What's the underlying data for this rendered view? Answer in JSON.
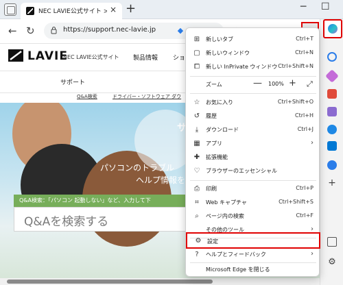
{
  "tab": {
    "title": "NEC LAVIE公式サイト > サービス＆サ",
    "close": "×",
    "new_tab": "+"
  },
  "window": {
    "minimize": "─",
    "maximize": "☐"
  },
  "address": {
    "url": "https://support.nec-lavie.jp"
  },
  "toolbar": {
    "more": "···",
    "read_aloud": "Aᴬ"
  },
  "site": {
    "logo_text": "LAVIE",
    "site_name": "NEC LAVIE公式サイト",
    "nav_product": "製品情報",
    "nav_cut": "ショ",
    "support": "サポート",
    "links": [
      "Q&A検索",
      "ドライバー・ソフトウェア ダウ"
    ]
  },
  "hero": {
    "heading_partial": "サ",
    "line1": "パソコンのトラブル",
    "line2": "ヘルプ情報を",
    "qa_label": "Q&A検索：「パソコン 起動しない」など、入力して下",
    "qa_placeholder": "Q&Aを検索する"
  },
  "menu": {
    "items": [
      {
        "label": "新しいタブ",
        "shortcut": "Ctrl+T",
        "icon": "new-tab-icon"
      },
      {
        "label": "新しいウィンドウ",
        "shortcut": "Ctrl+N",
        "icon": "new-window-icon"
      },
      {
        "label": "新しい InPrivate ウィンドウ",
        "shortcut": "Ctrl+Shift+N",
        "icon": "inprivate-icon"
      }
    ],
    "zoom": {
      "label": "ズーム",
      "minus": "—",
      "value": "100%",
      "plus": "+",
      "full": "⤢"
    },
    "items2": [
      {
        "label": "お気に入り",
        "shortcut": "Ctrl+Shift+O",
        "icon": "favorites-icon"
      },
      {
        "label": "履歴",
        "shortcut": "Ctrl+H",
        "icon": "history-icon"
      },
      {
        "label": "ダウンロード",
        "shortcut": "Ctrl+J",
        "icon": "download-icon"
      },
      {
        "label": "アプリ",
        "shortcut": "",
        "icon": "apps-icon",
        "arrow": "›"
      },
      {
        "label": "拡張機能",
        "shortcut": "",
        "icon": "extensions-icon"
      },
      {
        "label": "ブラウザーのエッセンシャル",
        "shortcut": "",
        "icon": "heart-pulse-icon"
      }
    ],
    "items3": [
      {
        "label": "印刷",
        "shortcut": "Ctrl+P",
        "icon": "print-icon"
      },
      {
        "label": "Web キャプチャ",
        "shortcut": "Ctrl+Shift+S",
        "icon": "web-capture-icon"
      },
      {
        "label": "ページ内の検索",
        "shortcut": "Ctrl+F",
        "icon": "find-icon"
      },
      {
        "label": "その他のツール",
        "shortcut": "",
        "icon": "",
        "arrow": "›"
      }
    ],
    "items4": [
      {
        "label": "設定",
        "shortcut": "",
        "icon": "settings-icon"
      },
      {
        "label": "ヘルプとフィードバック",
        "shortcut": "",
        "icon": "help-icon",
        "arrow": "›"
      },
      {
        "label": "Microsoft Edge を閉じる",
        "shortcut": "",
        "icon": ""
      }
    ]
  },
  "colors": {
    "highlight": "#e00000",
    "qa_green": "#77ae5a",
    "accent_blue": "#2b7de9"
  }
}
